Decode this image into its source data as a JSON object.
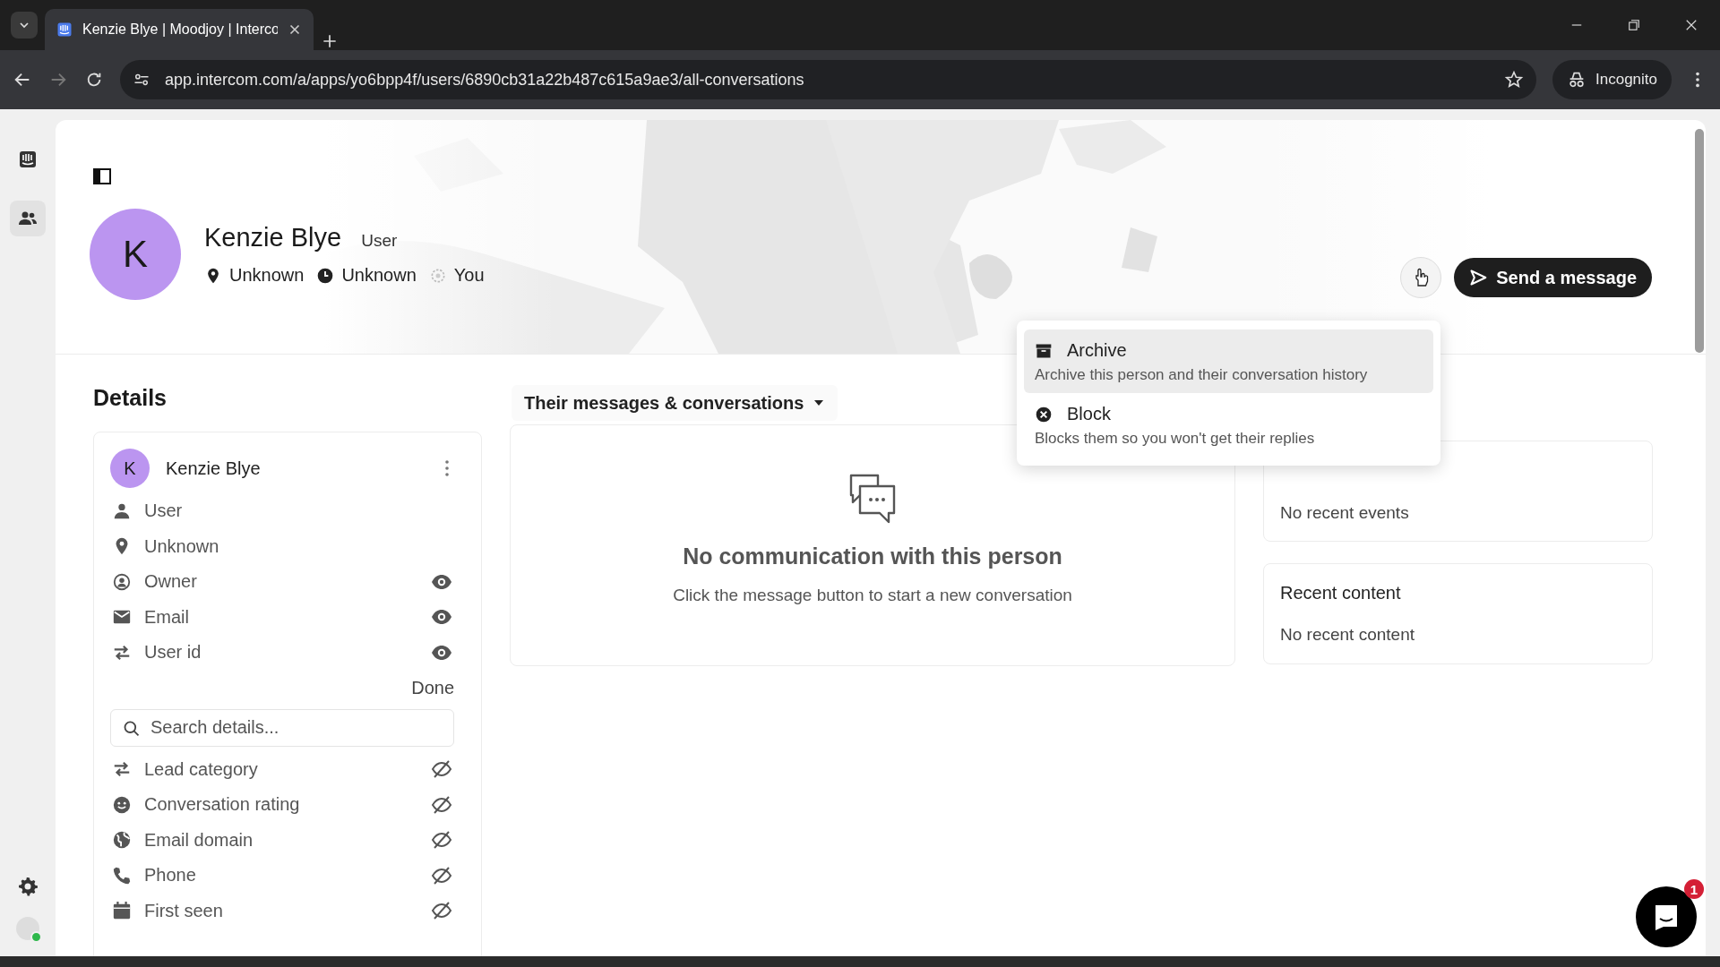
{
  "browser": {
    "tabs": [
      {
        "title": "Kenzie Blye | Moodjoy | Intercо",
        "selected": true
      }
    ],
    "url": "app.intercom.com/a/apps/yo6bpp4f/users/6890cb31a22b487c615a9ae3/all-conversations",
    "profile_label": "Incognito"
  },
  "rail": {
    "items": [
      {
        "kind": "inbox",
        "selected": false
      },
      {
        "kind": "contacts",
        "selected": true
      }
    ],
    "status_online": true
  },
  "profile": {
    "initial": "K",
    "name": "Kenzie Blye",
    "role": "User",
    "meta": [
      {
        "kind": "location",
        "text": "Unknown"
      },
      {
        "kind": "time",
        "text": "Unknown"
      },
      {
        "kind": "owner",
        "text": "You"
      }
    ],
    "send_button": "Send a message"
  },
  "menu": {
    "items": [
      {
        "kind": "archive",
        "label": "Archive",
        "description": "Archive this person and their conversation history",
        "selected": true
      },
      {
        "kind": "block",
        "label": "Block",
        "description": "Blocks them so you won't get their replies",
        "selected": false
      }
    ]
  },
  "details": {
    "heading": "Details",
    "initial": "K",
    "name": "Kenzie Blye",
    "summary": [
      {
        "kind": "person",
        "label": "User"
      },
      {
        "kind": "location",
        "label": "Unknown"
      }
    ],
    "shown": [
      {
        "kind": "owner",
        "label": "Owner",
        "visible": true
      },
      {
        "kind": "email",
        "label": "Email",
        "visible": true
      },
      {
        "kind": "swap",
        "label": "User id",
        "visible": true
      }
    ],
    "done_button": "Done",
    "search": {
      "placeholder": "Search details..."
    },
    "available": [
      {
        "kind": "swap",
        "label": "Lead category",
        "visible": false
      },
      {
        "kind": "smile",
        "label": "Conversation rating",
        "visible": false
      },
      {
        "kind": "globe",
        "label": "Email domain",
        "visible": false
      },
      {
        "kind": "phone",
        "label": "Phone",
        "visible": false
      },
      {
        "kind": "calendar",
        "label": "First seen",
        "visible": false
      }
    ]
  },
  "conversations": {
    "filter": "Their messages & conversations",
    "empty_title": "No communication with this person",
    "empty_text": "Click the message button to start a new conversation"
  },
  "activity": {
    "cards": [
      {
        "text": "No recent events"
      },
      {
        "title": "Recent content",
        "text": "No recent content"
      }
    ]
  },
  "messenger": {
    "badge": "1"
  }
}
